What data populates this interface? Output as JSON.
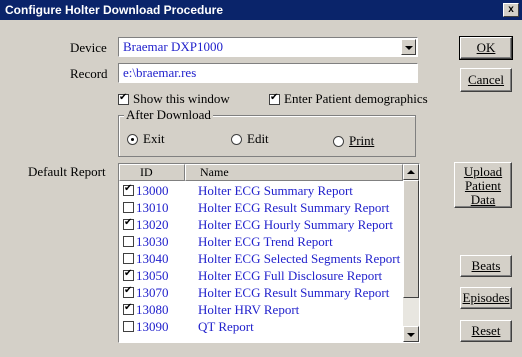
{
  "window": {
    "title": "Configure Holter Download Procedure",
    "close_label": "x"
  },
  "device": {
    "label": "Device",
    "value": "Braemar DXP1000"
  },
  "record": {
    "label": "Record",
    "value": "e:\\braemar.res"
  },
  "options": {
    "show_window": {
      "label": "Show this window",
      "checked": true
    },
    "patient_demographics": {
      "label": "Enter Patient demographics",
      "checked": true
    }
  },
  "after_download": {
    "label": "After Download",
    "exit": "Exit",
    "edit": "Edit",
    "print": "Print",
    "selected": "exit"
  },
  "default_report": {
    "label": "Default Report",
    "col_id": "ID",
    "col_name": "Name",
    "rows": [
      {
        "id": "13000",
        "name": "Holter ECG Summary Report",
        "checked": true
      },
      {
        "id": "13010",
        "name": "Holter ECG Result Summary Report",
        "checked": false
      },
      {
        "id": "13020",
        "name": "Holter ECG Hourly Summary Report",
        "checked": true
      },
      {
        "id": "13030",
        "name": "Holter ECG Trend Report",
        "checked": false
      },
      {
        "id": "13040",
        "name": "Holter ECG Selected Segments Report",
        "checked": false
      },
      {
        "id": "13050",
        "name": "Holter ECG Full Disclosure Report",
        "checked": true
      },
      {
        "id": "13070",
        "name": "Holter ECG Result Summary Report",
        "checked": true
      },
      {
        "id": "13080",
        "name": "Holter HRV Report",
        "checked": true
      },
      {
        "id": "13090",
        "name": "QT Report",
        "checked": false
      }
    ]
  },
  "buttons": {
    "ok": "OK",
    "cancel": "Cancel",
    "upload_line1": "Upload",
    "upload_line2": "Patient",
    "upload_line3": "Data",
    "beats": "Beats",
    "episodes": "Episodes",
    "reset": "Reset"
  },
  "colors": {
    "titlebar": "#0a246a",
    "dialog": "#d4d0c8",
    "value_text": "#2222cc"
  }
}
